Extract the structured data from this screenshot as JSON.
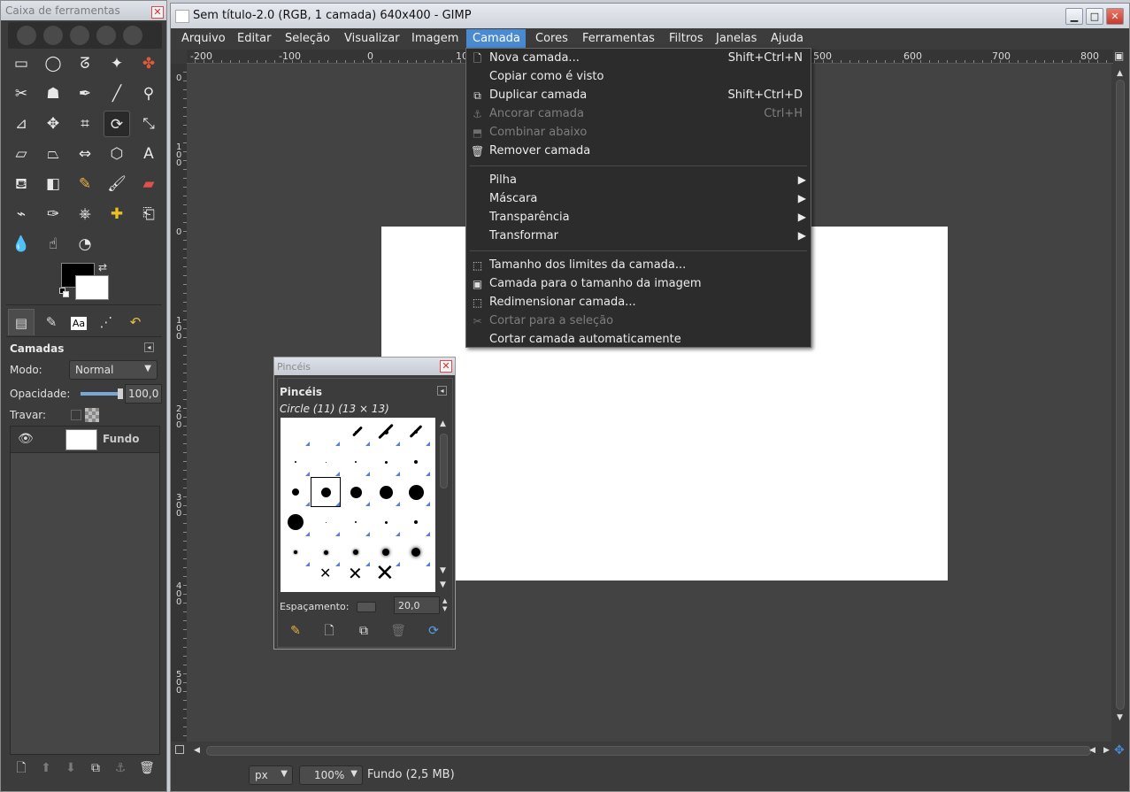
{
  "toolbox": {
    "title": "Caixa de ferramentas",
    "close_symbol": "✕",
    "tool_icons": [
      "rect-select-icon",
      "ellipse-select-icon",
      "free-select-icon",
      "fuzzy-select-icon",
      "color-select-icon",
      "scissors-select-icon",
      "foreground-select-icon",
      "paths-icon",
      "color-picker-icon",
      "zoom-icon",
      "measure-icon",
      "move-icon",
      "crop-icon",
      "rotate-icon",
      "scale-icon",
      "shear-icon",
      "perspective-icon",
      "flip-icon",
      "cage-icon",
      "text-icon",
      "bucket-fill-icon",
      "blend-icon",
      "pencil-icon",
      "paintbrush-icon",
      "eraser-icon",
      "airbrush-icon",
      "ink-icon",
      "clone-icon",
      "heal-icon",
      "perspective-clone-icon",
      "blur-icon",
      "smudge-icon",
      "dodge-burn-icon"
    ],
    "fg_color": "#000000",
    "bg_color": "#ffffff"
  },
  "layers": {
    "title": "Camadas",
    "mode_label": "Modo:",
    "mode_value": "Normal",
    "opacity_label": "Opacidade:",
    "opacity_value": "100,0",
    "opacity_fraction": 1.0,
    "lock_label": "Travar:",
    "layer_name": "Fundo"
  },
  "main_window": {
    "title": "Sem título-2.0 (RGB, 1 camada) 640x400 - GIMP",
    "min_symbol": "▁",
    "max_symbol": "□",
    "close_symbol": "✕"
  },
  "menubar": [
    {
      "label": "Arquivo"
    },
    {
      "label": "Editar"
    },
    {
      "label": "Seleção"
    },
    {
      "label": "Visualizar"
    },
    {
      "label": "Imagem"
    },
    {
      "label": "Camada"
    },
    {
      "label": "Cores"
    },
    {
      "label": "Ferramentas"
    },
    {
      "label": "Filtros"
    },
    {
      "label": "Janelas"
    },
    {
      "label": "Ajuda"
    }
  ],
  "ruler_h_labels": [
    "-200",
    "-100",
    "0",
    "10",
    "500",
    "600",
    "700",
    "800"
  ],
  "ruler_v_labels": [
    "0",
    "1 0 0",
    "0",
    "1 0 0",
    "2 0 0",
    "3 0 0",
    "4 0 0",
    "5 0 0"
  ],
  "dropdown": {
    "items": [
      {
        "label": "Nova camada...",
        "shortcut": "Shift+Ctrl+N",
        "icon": "new-layer-icon",
        "disabled": false
      },
      {
        "label": "Copiar como é visto",
        "shortcut": "",
        "icon": "",
        "disabled": false
      },
      {
        "label": "Duplicar camada",
        "shortcut": "Shift+Ctrl+D",
        "icon": "duplicate-layer-icon",
        "disabled": false
      },
      {
        "label": "Ancorar camada",
        "shortcut": "Ctrl+H",
        "icon": "anchor-icon",
        "disabled": true
      },
      {
        "label": "Combinar abaixo",
        "shortcut": "",
        "icon": "merge-down-icon",
        "disabled": true
      },
      {
        "label": "Remover camada",
        "shortcut": "",
        "icon": "trash-icon",
        "disabled": false
      },
      {
        "label": "Pilha",
        "submenu": true
      },
      {
        "label": "Máscara",
        "submenu": true
      },
      {
        "label": "Transparência",
        "submenu": true
      },
      {
        "label": "Transformar",
        "submenu": true
      },
      {
        "label": "Tamanho dos limites da camada...",
        "icon": "layer-boundary-icon",
        "disabled": false
      },
      {
        "label": "Camada para o tamanho da imagem",
        "icon": "layer-to-image-icon",
        "disabled": false
      },
      {
        "label": "Redimensionar camada...",
        "icon": "scale-layer-icon",
        "disabled": false
      },
      {
        "label": "Cortar para a seleção",
        "icon": "crop-to-selection-icon",
        "disabled": true
      },
      {
        "label": "Cortar camada automaticamente",
        "icon": "",
        "disabled": false
      }
    ],
    "submenu_symbol": "▶"
  },
  "brushes": {
    "window_title": "Pincéis",
    "heading": "Pincéis",
    "current": "Circle (11) (13 × 13)",
    "spacing_label": "Espaçamento:",
    "spacing_value": "20,0"
  },
  "status": {
    "unit": "px",
    "zoom": "100%",
    "text": "Fundo (2,5 MB)"
  }
}
